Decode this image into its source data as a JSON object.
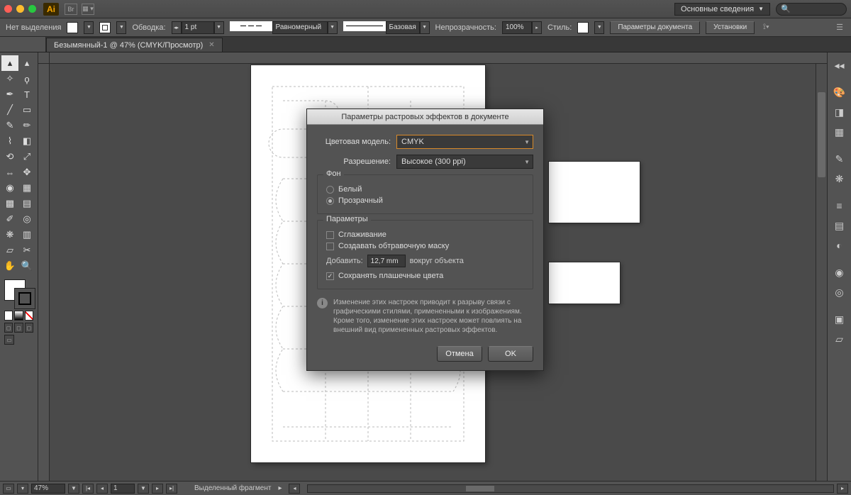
{
  "menubar": {
    "ai": "Ai",
    "br": "Br",
    "workspace": "Основные сведения"
  },
  "controlbar": {
    "no_selection": "Нет выделения",
    "stroke_label": "Обводка:",
    "stroke_weight": "1 pt",
    "uniform": "Равномерный",
    "basic": "Базовая",
    "opacity_label": "Непрозрачность:",
    "opacity_value": "100%",
    "style_label": "Стиль:",
    "doc_params_btn": "Параметры документа",
    "settings_btn": "Установки"
  },
  "doctab": {
    "title": "Безымянный-1 @ 47% (CMYK/Просмотр)"
  },
  "statusbar": {
    "zoom": "47%",
    "artboard": "1",
    "label": "Выделенный фрагмент"
  },
  "dialog": {
    "title": "Параметры растровых эффектов в документе",
    "color_model_label": "Цветовая модель:",
    "color_model_value": "CMYK",
    "resolution_label": "Разрешение:",
    "resolution_value": "Высокое (300 ppi)",
    "bg_legend": "Фон",
    "bg_white": "Белый",
    "bg_transparent": "Прозрачный",
    "params_legend": "Параметры",
    "antialias": "Сглаживание",
    "clip_mask": "Создавать обтравочную маску",
    "add_label": "Добавить:",
    "add_value": "12,7 mm",
    "around_label": "вокруг объекта",
    "preserve_spot": "Сохранять плашечные цвета",
    "info": "Изменение этих настроек приводит к разрыву связи с графическими стилями, примененными к изображениям. Кроме того, изменение этих настроек может повлиять на внешний вид примененных растровых эффектов.",
    "cancel": "Отмена",
    "ok": "OK"
  }
}
